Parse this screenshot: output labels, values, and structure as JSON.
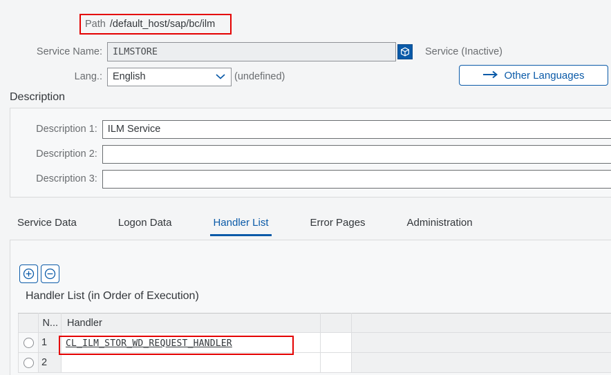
{
  "header": {
    "path_label": "Path",
    "path_value": "/default_host/sap/bc/ilm",
    "service_name_label": "Service Name:",
    "service_name_value": "ILMSTORE",
    "package_icon": "cube-icon",
    "service_status": "Service (Inactive)",
    "lang_label": "Lang.:",
    "lang_value": "English",
    "lang_note": "(undefined)",
    "other_languages_label": "Other Languages",
    "other_languages_icon": "arrow-right-icon"
  },
  "description": {
    "section_title": "Description",
    "rows": [
      {
        "label": "Description 1:",
        "value": "ILM Service"
      },
      {
        "label": "Description 2:",
        "value": ""
      },
      {
        "label": "Description 3:",
        "value": ""
      }
    ]
  },
  "tabs": [
    {
      "label": "Service Data",
      "active": false
    },
    {
      "label": "Logon Data",
      "active": false
    },
    {
      "label": "Handler List",
      "active": true
    },
    {
      "label": "Error Pages",
      "active": false
    },
    {
      "label": "Administration",
      "active": false
    }
  ],
  "handler_panel": {
    "add_icon": "plus-circle-icon",
    "remove_icon": "minus-circle-icon",
    "caption": "Handler List (in Order of Execution)",
    "columns": {
      "select": "",
      "number": "N...",
      "handler": "Handler",
      "gap": "",
      "rest": ""
    },
    "rows": [
      {
        "number": "1",
        "handler": "CL_ILM_STOR_WD_REQUEST_HANDLER"
      },
      {
        "number": "2",
        "handler": ""
      }
    ]
  },
  "colors": {
    "accent_blue": "#0a5aa8",
    "annotation_red": "#e40000",
    "page_background": "#f4f5f6",
    "label_gray": "#6a6d70"
  }
}
